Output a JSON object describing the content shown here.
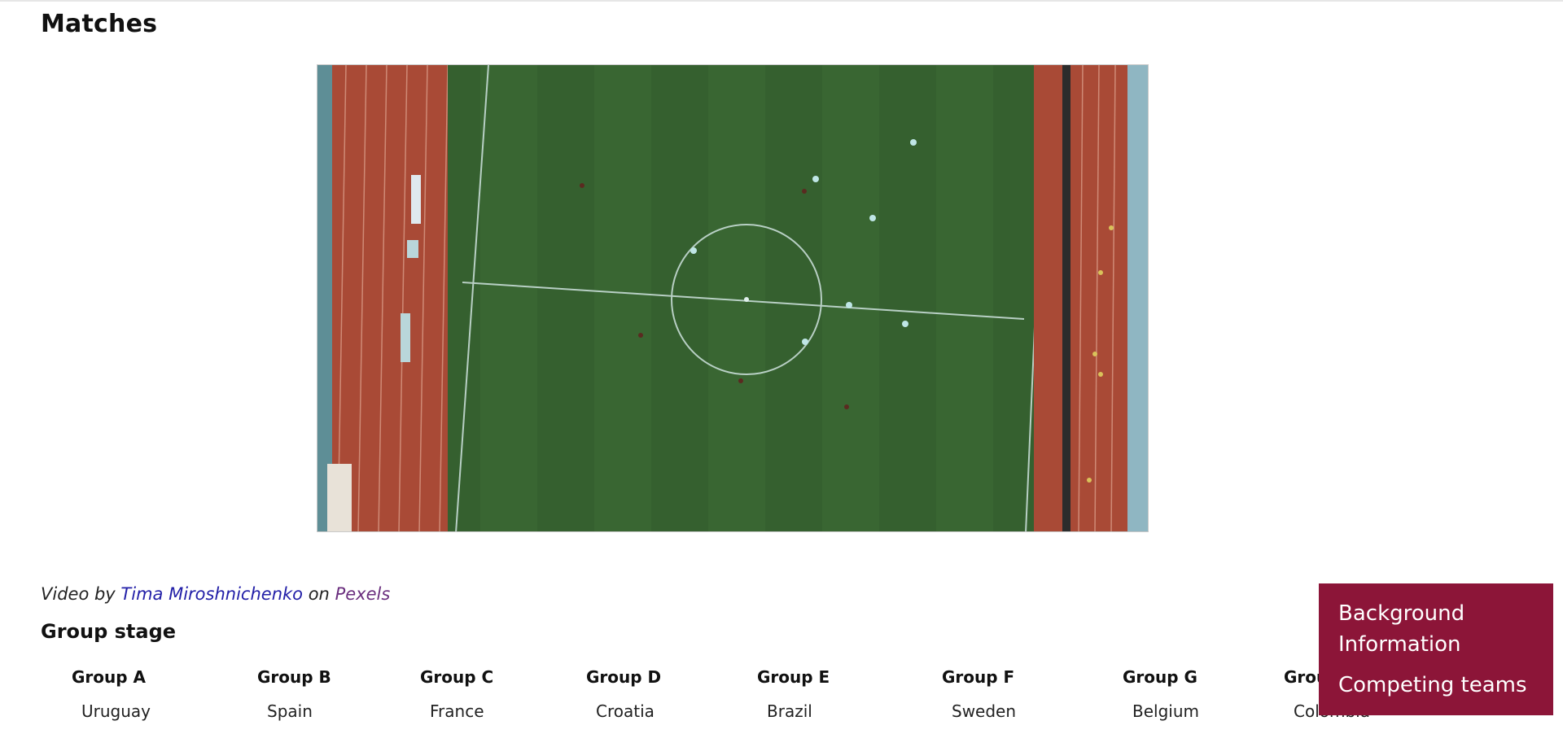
{
  "page": {
    "title": "Matches"
  },
  "video": {
    "content": "aerial stadium football pitch"
  },
  "credit": {
    "prefix": "Video by",
    "author": "Tima Miroshnichenko",
    "middle": "on",
    "site": "Pexels"
  },
  "group_stage": {
    "title": "Group stage",
    "groups": [
      {
        "name": "Group A",
        "first_team": "Uruguay"
      },
      {
        "name": "Group B",
        "first_team": "Spain"
      },
      {
        "name": "Group C",
        "first_team": "France"
      },
      {
        "name": "Group D",
        "first_team": "Croatia"
      },
      {
        "name": "Group E",
        "first_team": "Brazil"
      },
      {
        "name": "Group F",
        "first_team": "Sweden"
      },
      {
        "name": "Group G",
        "first_team": "Belgium"
      },
      {
        "name": "Group H",
        "first_team": "Colombia"
      }
    ]
  },
  "menu": {
    "items": [
      {
        "label": "Background Information"
      },
      {
        "label": "Competing teams"
      }
    ],
    "background_color": "#8c1538"
  }
}
